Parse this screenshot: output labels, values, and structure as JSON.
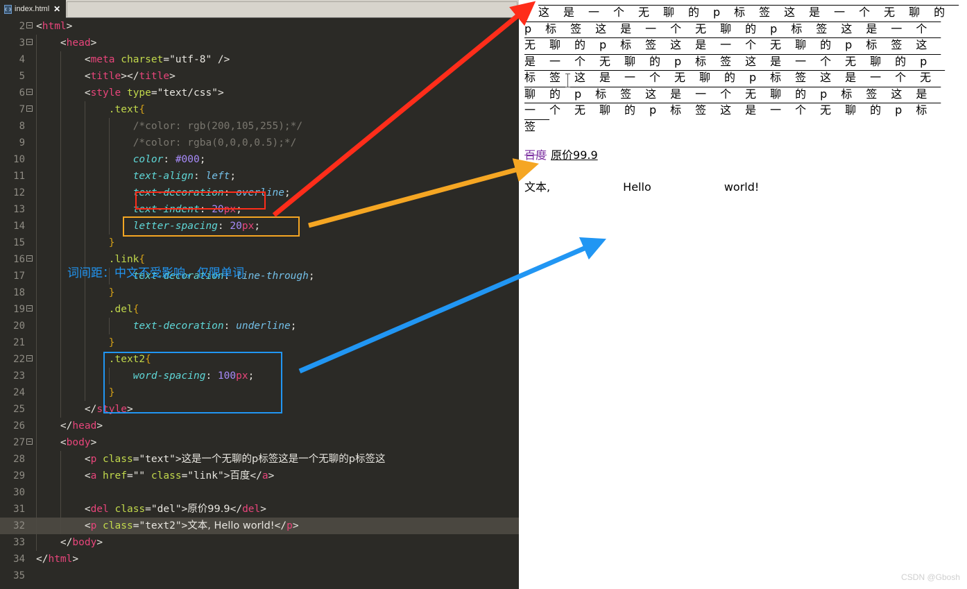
{
  "window": {
    "tab_label": "index.html",
    "tab_close": "✕",
    "file_icon": "html-file-icon"
  },
  "editor": {
    "lines": [
      {
        "num": "2",
        "fold": true,
        "html": "<span class=\"pn\">&lt;</span><span class=\"tg\">html</span><span class=\"pn\">&gt;</span>",
        "indent": 0
      },
      {
        "num": "3",
        "fold": true,
        "html": "    <span class=\"pn\">&lt;</span><span class=\"tg\">head</span><span class=\"pn\">&gt;</span>",
        "indent": 1
      },
      {
        "num": "4",
        "fold": false,
        "html": "        <span class=\"pn\">&lt;</span><span class=\"tg\">meta</span> <span class=\"at\">charset</span><span class=\"pn\">=</span><span class=\"st\">\"utf-8\"</span> <span class=\"pn\">/&gt;</span>",
        "indent": 2
      },
      {
        "num": "5",
        "fold": false,
        "html": "        <span class=\"pn\">&lt;</span><span class=\"tg\">title</span><span class=\"pn\">&gt;&lt;/</span><span class=\"tg\">title</span><span class=\"pn\">&gt;</span>",
        "indent": 2
      },
      {
        "num": "6",
        "fold": true,
        "html": "        <span class=\"pn\">&lt;</span><span class=\"tg\">style</span> <span class=\"at\">type</span><span class=\"pn\">=</span><span class=\"st\">\"text/css\"</span><span class=\"pn\">&gt;</span>",
        "indent": 2
      },
      {
        "num": "7",
        "fold": true,
        "html": "            <span class=\"sel\">.text</span><span class=\"brc\">{</span>",
        "indent": 3
      },
      {
        "num": "8",
        "fold": false,
        "html": "                <span class=\"cm\">/*color: rgb(200,105,255);*/</span>",
        "indent": 4
      },
      {
        "num": "9",
        "fold": false,
        "html": "                <span class=\"cm\">/*color: rgba(0,0,0,0.5);*/</span>",
        "indent": 4
      },
      {
        "num": "10",
        "fold": false,
        "html": "                <span class=\"prp\">color</span><span class=\"semi\">: </span><span class=\"num\">#000</span><span class=\"semi\">;</span>",
        "indent": 4
      },
      {
        "num": "11",
        "fold": false,
        "html": "                <span class=\"prp\">text-align</span><span class=\"semi\">: </span><span class=\"val\">left</span><span class=\"semi\">;</span>",
        "indent": 4
      },
      {
        "num": "12",
        "fold": false,
        "html": "                <span class=\"prp\">text-decoration</span><span class=\"semi\">: </span><span class=\"val\">overline</span><span class=\"semi\">;</span>",
        "indent": 4
      },
      {
        "num": "13",
        "fold": false,
        "html": "                <span class=\"prp\">text-indent</span><span class=\"semi\">: </span><span class=\"num\">20</span><span class=\"unit\">px</span><span class=\"semi\">;</span>",
        "indent": 4
      },
      {
        "num": "14",
        "fold": false,
        "html": "                <span class=\"prp\">letter-spacing</span><span class=\"semi\">: </span><span class=\"num\">20</span><span class=\"unit\">px</span><span class=\"semi\">;</span>",
        "indent": 4
      },
      {
        "num": "15",
        "fold": false,
        "html": "            <span class=\"brc\">}</span>",
        "indent": 3
      },
      {
        "num": "16",
        "fold": true,
        "html": "            <span class=\"sel\">.link</span><span class=\"brc\">{</span>",
        "indent": 3
      },
      {
        "num": "17",
        "fold": false,
        "html": "                <span class=\"prp\">text-decoration</span><span class=\"semi\">: </span><span class=\"val\">line-through</span><span class=\"semi\">;</span>",
        "indent": 4
      },
      {
        "num": "18",
        "fold": false,
        "html": "            <span class=\"brc\">}</span>",
        "indent": 3
      },
      {
        "num": "19",
        "fold": true,
        "html": "            <span class=\"sel\">.del</span><span class=\"brc\">{</span>",
        "indent": 3
      },
      {
        "num": "20",
        "fold": false,
        "html": "                <span class=\"prp\">text-decoration</span><span class=\"semi\">: </span><span class=\"val\">underline</span><span class=\"semi\">;</span>",
        "indent": 4
      },
      {
        "num": "21",
        "fold": false,
        "html": "            <span class=\"brc\">}</span>",
        "indent": 3
      },
      {
        "num": "22",
        "fold": true,
        "html": "            <span class=\"sel\">.text2</span><span class=\"brc\">{</span>",
        "indent": 3
      },
      {
        "num": "23",
        "fold": false,
        "html": "                <span class=\"prp\">word-spacing</span><span class=\"semi\">: </span><span class=\"num\">100</span><span class=\"unit\">px</span><span class=\"semi\">;</span>",
        "indent": 4
      },
      {
        "num": "24",
        "fold": false,
        "html": "            <span class=\"brc\">}</span>",
        "indent": 3
      },
      {
        "num": "25",
        "fold": false,
        "html": "        <span class=\"pn\">&lt;/</span><span class=\"tg\">style</span><span class=\"pn\">&gt;</span>",
        "indent": 2
      },
      {
        "num": "26",
        "fold": false,
        "html": "    <span class=\"pn\">&lt;/</span><span class=\"tg\">head</span><span class=\"pn\">&gt;</span>",
        "indent": 1
      },
      {
        "num": "27",
        "fold": true,
        "html": "    <span class=\"pn\">&lt;</span><span class=\"tg\">body</span><span class=\"pn\">&gt;</span>",
        "indent": 1
      },
      {
        "num": "28",
        "fold": false,
        "html": "        <span class=\"pn\">&lt;</span><span class=\"tg\">p</span> <span class=\"at\">class</span><span class=\"pn\">=</span><span class=\"st\">\"text\"</span><span class=\"pn\">&gt;</span><span class=\"cjk\">这是一个无聊的p标签这是一个无聊的p标签这</span>",
        "indent": 2
      },
      {
        "num": "29",
        "fold": false,
        "html": "        <span class=\"pn\">&lt;</span><span class=\"tg\">a</span> <span class=\"at\">href</span><span class=\"pn\">=</span><span class=\"st\">\"\"</span> <span class=\"at\">class</span><span class=\"pn\">=</span><span class=\"st\">\"link\"</span><span class=\"pn\">&gt;</span><span class=\"cjk\">百度</span><span class=\"pn\">&lt;/</span><span class=\"tg\">a</span><span class=\"pn\">&gt;</span>",
        "indent": 2
      },
      {
        "num": "30",
        "fold": false,
        "html": "",
        "indent": 2
      },
      {
        "num": "31",
        "fold": false,
        "html": "        <span class=\"pn\">&lt;</span><span class=\"tg\">del</span> <span class=\"at\">class</span><span class=\"pn\">=</span><span class=\"st\">\"del\"</span><span class=\"pn\">&gt;</span><span class=\"cjk\">原价99.9</span><span class=\"pn\">&lt;/</span><span class=\"tg\">del</span><span class=\"pn\">&gt;</span>",
        "indent": 2
      },
      {
        "num": "32",
        "fold": false,
        "active": true,
        "html": "        <span class=\"pn\">&lt;</span><span class=\"tg\">p</span> <span class=\"at\">class</span><span class=\"pn\">=</span><span class=\"st\">\"text2\"</span><span class=\"pn\">&gt;</span><span class=\"cjk\">文本, Hello world!</span><span class=\"pn\">&lt;/</span><span class=\"tg\">p</span><span class=\"pn\">&gt;</span>",
        "indent": 2
      },
      {
        "num": "33",
        "fold": false,
        "html": "    <span class=\"pn\">&lt;/</span><span class=\"tg\">body</span><span class=\"pn\">&gt;</span>",
        "indent": 1
      },
      {
        "num": "34",
        "fold": false,
        "html": "<span class=\"pn\">&lt;/</span><span class=\"tg\">html</span><span class=\"pn\">&gt;</span>",
        "indent": 0
      },
      {
        "num": "35",
        "fold": false,
        "html": "",
        "indent": 0
      }
    ],
    "highlight_boxes": [
      {
        "name": "text-indent-box",
        "color": "#ff2d1a",
        "target": "text-indent: 20px;"
      },
      {
        "name": "letter-spacing-box",
        "color": "#f5a623",
        "target": "letter-spacing: 20px;"
      },
      {
        "name": "text2-rule-box",
        "color": "#2196f3",
        "target": ".text2{ word-spacing: 100px; }"
      }
    ]
  },
  "render": {
    "paragraph_text": "这是一个无聊的p标签这是一个无聊的p标签这是一个无聊的p标签这是一个无聊的p标签这是一个无聊的p标签这是一个无聊的p标签这是一个无聊的p标签这是一个无聊的p标签这是一个无聊的p标签这是一个无聊的p标签这是一个无聊的p标签这是一个无聊的p标签",
    "link_label": "百度",
    "del_label": "原价99.9",
    "text2": "文本, Hello world!",
    "note": "词间距：中文不受影响，仅限单词",
    "link_color": "#7b2fa0",
    "note_color": "#2196f3"
  },
  "watermark": "CSDN @Gbosh"
}
